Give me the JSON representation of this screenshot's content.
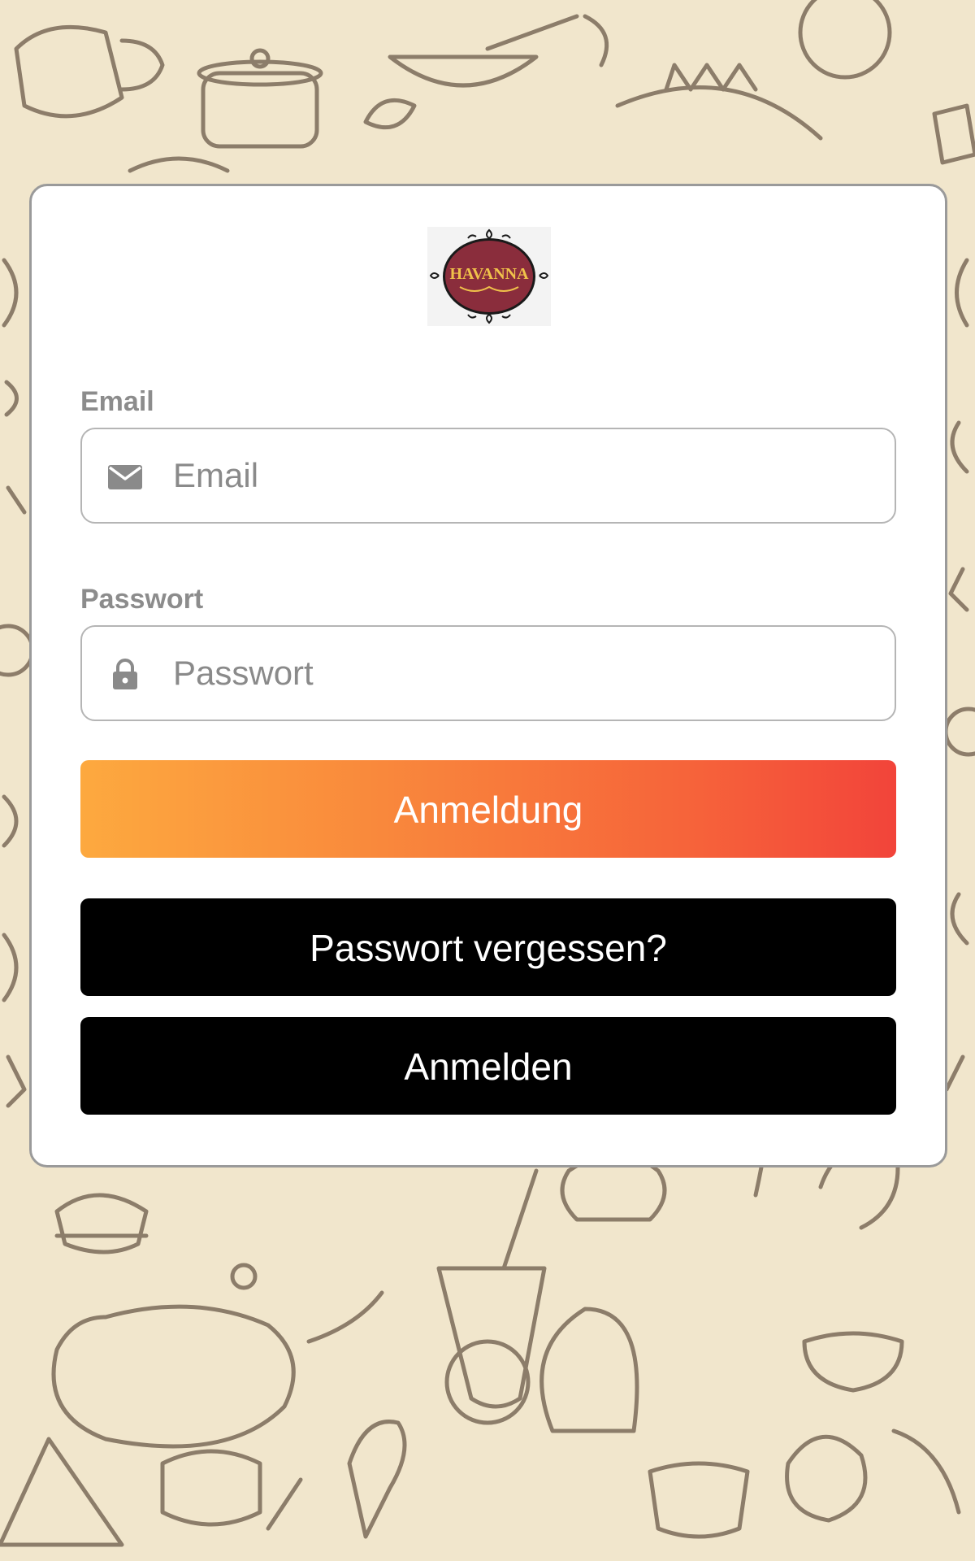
{
  "brand": {
    "logo_text": "HAVANNA",
    "logo_color": "#8a2d3c"
  },
  "form": {
    "email": {
      "label": "Email",
      "placeholder": "Email",
      "value": ""
    },
    "password": {
      "label": "Passwort",
      "placeholder": "Passwort",
      "value": ""
    }
  },
  "buttons": {
    "login_label": "Anmeldung",
    "forgot_label": "Passwort vergessen?",
    "signin_label": "Anmelden"
  },
  "colors": {
    "primary_gradient_start": "#fda93f",
    "primary_gradient_end": "#f2443a",
    "dark_button": "#000000",
    "background": "#f1e6cc",
    "doodle_stroke": "#6b5a4a"
  },
  "icons": {
    "email": "envelope-icon",
    "password": "lock-icon"
  }
}
